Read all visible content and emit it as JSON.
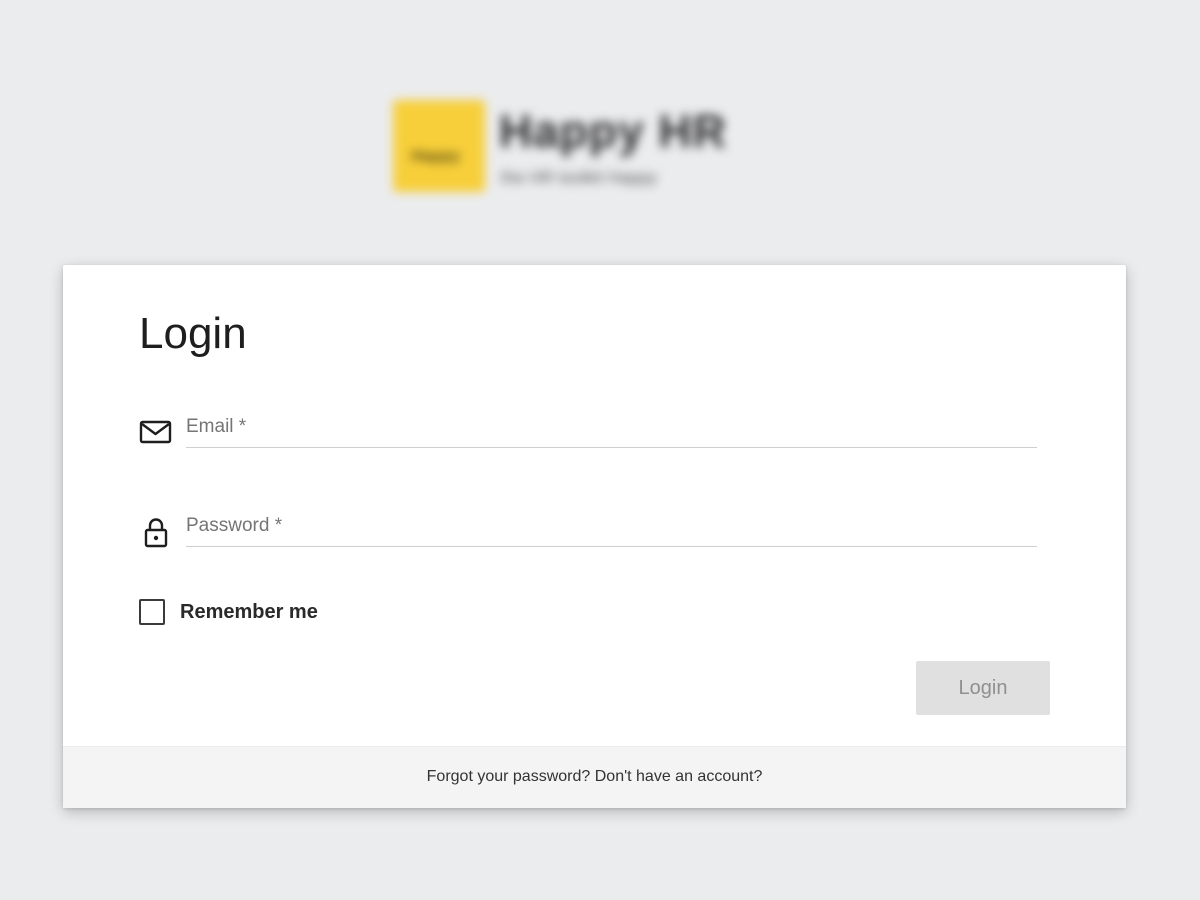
{
  "brand": {
    "mark_text": "Happy",
    "name": "Happy HR",
    "tagline": "the HR toolkit Happy"
  },
  "login": {
    "title": "Login",
    "email_placeholder": "Email *",
    "email_value": "",
    "password_placeholder": "Password *",
    "password_value": "",
    "remember_label": "Remember me",
    "remember_checked": false,
    "submit_label": "Login"
  },
  "footer": {
    "forgot_link": "Forgot your password?",
    "signup_link": "Don't have an account?"
  },
  "icons": {
    "email": "envelope-icon",
    "password": "lock-icon"
  },
  "colors": {
    "background": "#ebecee",
    "card": "#ffffff",
    "brand_yellow": "#f7cf3a",
    "button_disabled": "#e0e0e0",
    "footer_bg": "#f4f4f4"
  }
}
